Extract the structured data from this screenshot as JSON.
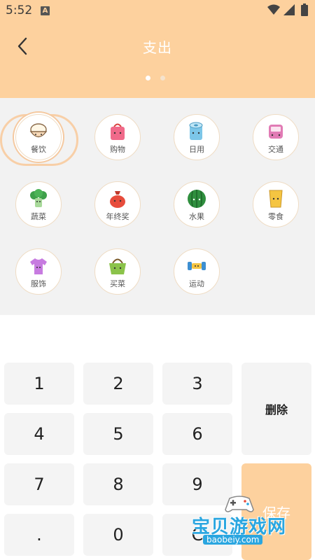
{
  "status_bar": {
    "time": "5:52",
    "notification_icon": "A"
  },
  "header": {
    "title": "支出",
    "back_icon": "chevron-left-icon",
    "pager": {
      "pages": 2,
      "active": 1
    }
  },
  "categories": [
    {
      "label": "餐饮",
      "icon": "rice-bowl-icon",
      "selected": true
    },
    {
      "label": "购物",
      "icon": "shopping-bag-icon",
      "selected": false
    },
    {
      "label": "日用",
      "icon": "toilet-paper-icon",
      "selected": false
    },
    {
      "label": "交通",
      "icon": "bus-icon",
      "selected": false
    },
    {
      "label": "蔬菜",
      "icon": "broccoli-icon",
      "selected": false
    },
    {
      "label": "年终奖",
      "icon": "money-bag-icon",
      "selected": false
    },
    {
      "label": "水果",
      "icon": "watermelon-icon",
      "selected": false
    },
    {
      "label": "零食",
      "icon": "snack-icon",
      "selected": false
    },
    {
      "label": "服饰",
      "icon": "tshirt-icon",
      "selected": false
    },
    {
      "label": "买菜",
      "icon": "basket-icon",
      "selected": false
    },
    {
      "label": "运动",
      "icon": "dumbbell-icon",
      "selected": false
    }
  ],
  "keypad": {
    "keys": [
      "1",
      "2",
      "3",
      "4",
      "5",
      "6",
      "7",
      "8",
      "9",
      ".",
      "0",
      "C"
    ],
    "delete_label": "删除",
    "save_label": "保存"
  },
  "watermark": {
    "text": "宝贝游戏网",
    "url": "baobeiy.com"
  },
  "colors": {
    "accent": "#fdd19e",
    "panel_bg": "#f2f2f2",
    "key_bg": "#f4f4f4"
  }
}
